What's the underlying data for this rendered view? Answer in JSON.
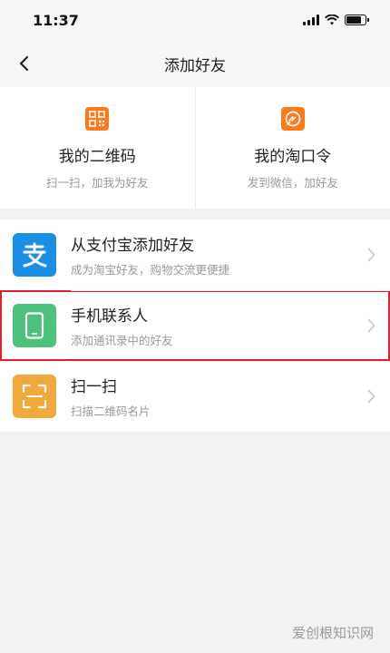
{
  "status_bar": {
    "time": "11:37"
  },
  "nav": {
    "title": "添加好友"
  },
  "top_cards": [
    {
      "title": "我的二维码",
      "subtitle": "扫一扫，加我为好友",
      "icon": "qr-code-icon"
    },
    {
      "title": "我的淘口令",
      "subtitle": "发到微信，加好友",
      "icon": "taokouling-icon"
    }
  ],
  "list": [
    {
      "title": "从支付宝添加好友",
      "subtitle": "成为淘宝好友，购物交流更便捷",
      "icon": "alipay-icon",
      "color": "#1b8fe6"
    },
    {
      "title": "手机联系人",
      "subtitle": "添加通讯录中的好友",
      "icon": "phone-icon",
      "color": "#4cc27a"
    },
    {
      "title": "扫一扫",
      "subtitle": "扫描二维码名片",
      "icon": "scan-icon",
      "color": "#f2a93b"
    }
  ],
  "watermark": "爱创根知识网",
  "colors": {
    "accent": "#ff6a00",
    "highlight_border": "#e0202a"
  }
}
